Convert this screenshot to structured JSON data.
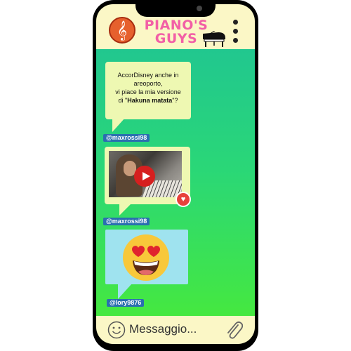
{
  "header": {
    "brand_line1": "PIANO'S",
    "brand_line2": "GUYS",
    "logo_icon": "treble-clef-icon",
    "menu_icon": "vertical-dots-icon",
    "piano_icon": "grand-piano-icon"
  },
  "messages": [
    {
      "text_line1": "AccorDisney anche in",
      "text_line2": "areoporto,",
      "text_line3": "vi piace la mia  versione",
      "text_line4_pre": "di \"",
      "text_line4_bold": "Hakuna matata",
      "text_line4_post": "\"?",
      "user": "@maxrossi98"
    },
    {
      "type": "video",
      "liked": true,
      "user": "@maxrossi98"
    },
    {
      "type": "emoji",
      "emoji": "heart-eyes-emoji",
      "user": "@lory9876"
    }
  ],
  "composer": {
    "placeholder": "Messaggio...",
    "emoji_icon": "smiley-icon",
    "attach_icon": "paperclip-icon"
  },
  "colors": {
    "header_bg": "#fbf7c6",
    "brand_pink": "#f25fa6",
    "bubble_yellow": "#eef8b2",
    "bubble_cyan": "#9fe3ef",
    "username_tag": "#2a6fb0",
    "screen_gradient_top": "#21c78f",
    "screen_gradient_bottom": "#45e840"
  }
}
